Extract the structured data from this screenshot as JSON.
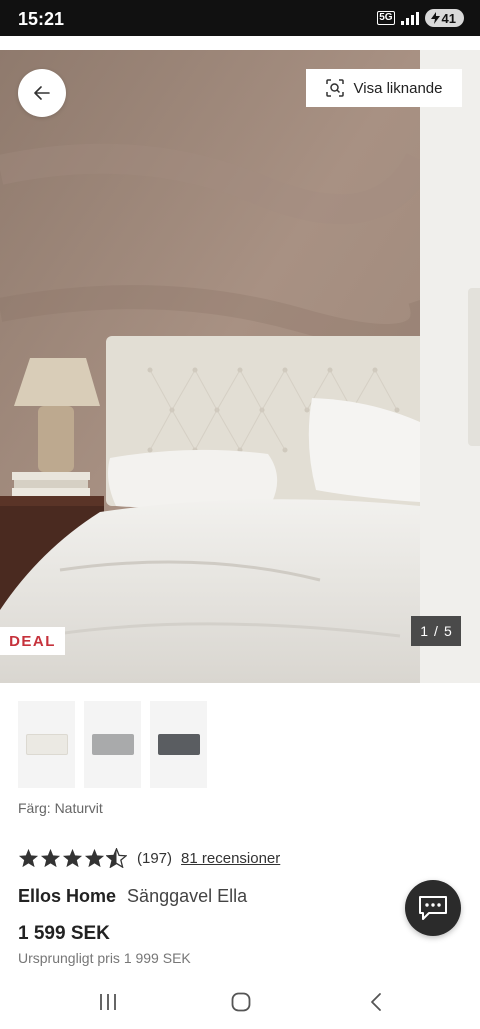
{
  "status_bar": {
    "time": "15:21",
    "network": "5G",
    "battery": "41",
    "battery_icon": "battery-charging-icon"
  },
  "gallery": {
    "visa_liknande_label": "Visa liknande",
    "deal_label": "DEAL",
    "counter_current": "1",
    "counter_sep": "/",
    "counter_total": "5",
    "image_subject": "bed with tufted headboard"
  },
  "thumbnails": [
    {
      "color_name": "natural-white",
      "swatch": "#ebe9e3"
    },
    {
      "color_name": "light-grey",
      "swatch": "#a9aaab"
    },
    {
      "color_name": "dark-grey",
      "swatch": "#5a5d61"
    }
  ],
  "product": {
    "color_label": "Färg: Naturvit",
    "rating": 4.5,
    "rating_count": "(197)",
    "reviews_link": "81 recensioner",
    "brand": "Ellos Home",
    "name": "Sänggavel Ella",
    "price": "1 599 SEK",
    "original_price": "Ursprungligt pris 1 999 SEK"
  },
  "icons": {
    "back": "arrow-left-icon",
    "visual_search": "visual-search-icon",
    "chat": "chat-icon",
    "nav_recent": "recent-apps-icon",
    "nav_home": "home-icon",
    "nav_back": "back-icon"
  },
  "colors": {
    "deal": "#c6323c",
    "chat_bg": "#2b2b2b",
    "counter_bg": "#4a4a4a"
  }
}
